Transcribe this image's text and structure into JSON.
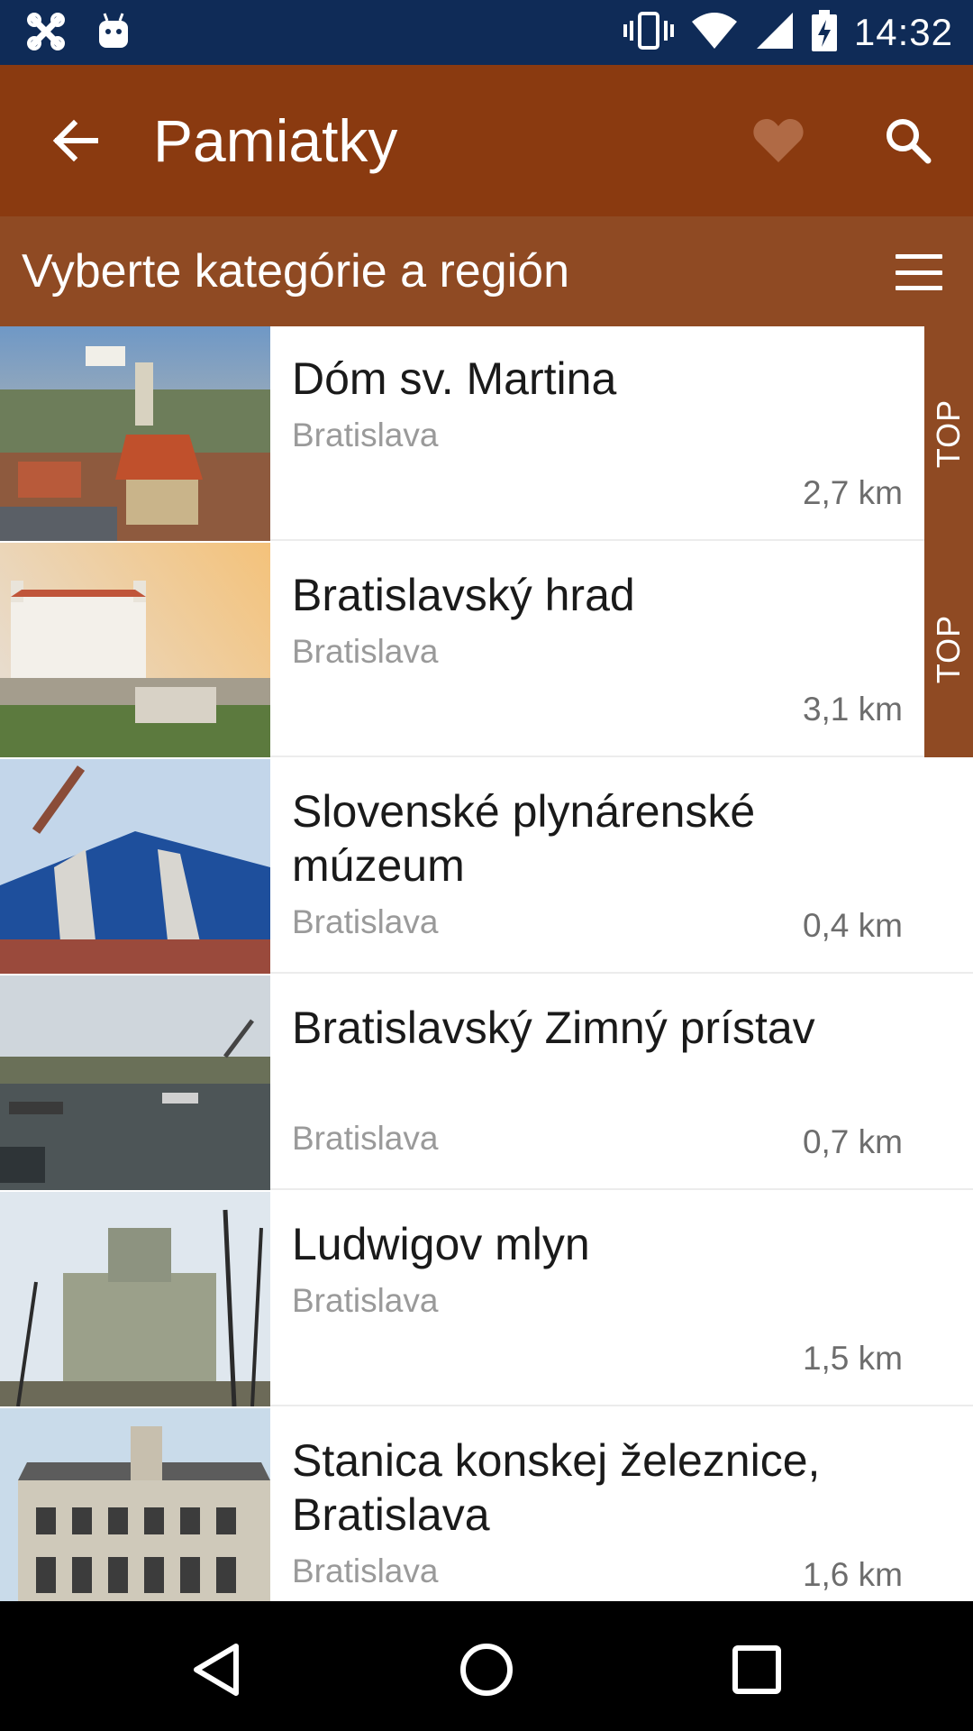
{
  "status_bar": {
    "time": "14:32",
    "icons": [
      "app-x-icon",
      "android-icon",
      "vibrate-icon",
      "wifi-icon",
      "signal-icon",
      "battery-charging-icon"
    ]
  },
  "toolbar": {
    "title": "Pamiatky",
    "back_icon": "arrow-left-icon",
    "favorite_icon": "heart-icon",
    "search_icon": "search-icon"
  },
  "subheader": {
    "label": "Vyberte kategórie a región",
    "menu_icon": "hamburger-icon"
  },
  "items": [
    {
      "title": "Dóm sv. Martina",
      "region": "Bratislava",
      "distance": "2,7 km",
      "badge": "TOP"
    },
    {
      "title": "Bratislavský hrad",
      "region": "Bratislava",
      "distance": "3,1 km",
      "badge": "TOP"
    },
    {
      "title": "Slovenské plynárenské múzeum",
      "region": "Bratislava",
      "distance": "0,4 km",
      "badge": ""
    },
    {
      "title": "Bratislavský Zimný prístav",
      "region": "Bratislava",
      "distance": "0,7 km",
      "badge": ""
    },
    {
      "title": "Ludwigov mlyn",
      "region": "Bratislava",
      "distance": "1,5 km",
      "badge": ""
    },
    {
      "title": "Stanica konskej železnice, Bratislava",
      "region": "Bratislava",
      "distance": "1,6 km",
      "badge": ""
    }
  ],
  "nav_bar": {
    "back_icon": "nav-back-icon",
    "home_icon": "nav-home-icon",
    "recents_icon": "nav-recents-icon"
  },
  "colors": {
    "status_bar": "#0f2b57",
    "toolbar": "#8a3a10",
    "subheader": "#8f4a23",
    "badge": "#8f4a23"
  }
}
